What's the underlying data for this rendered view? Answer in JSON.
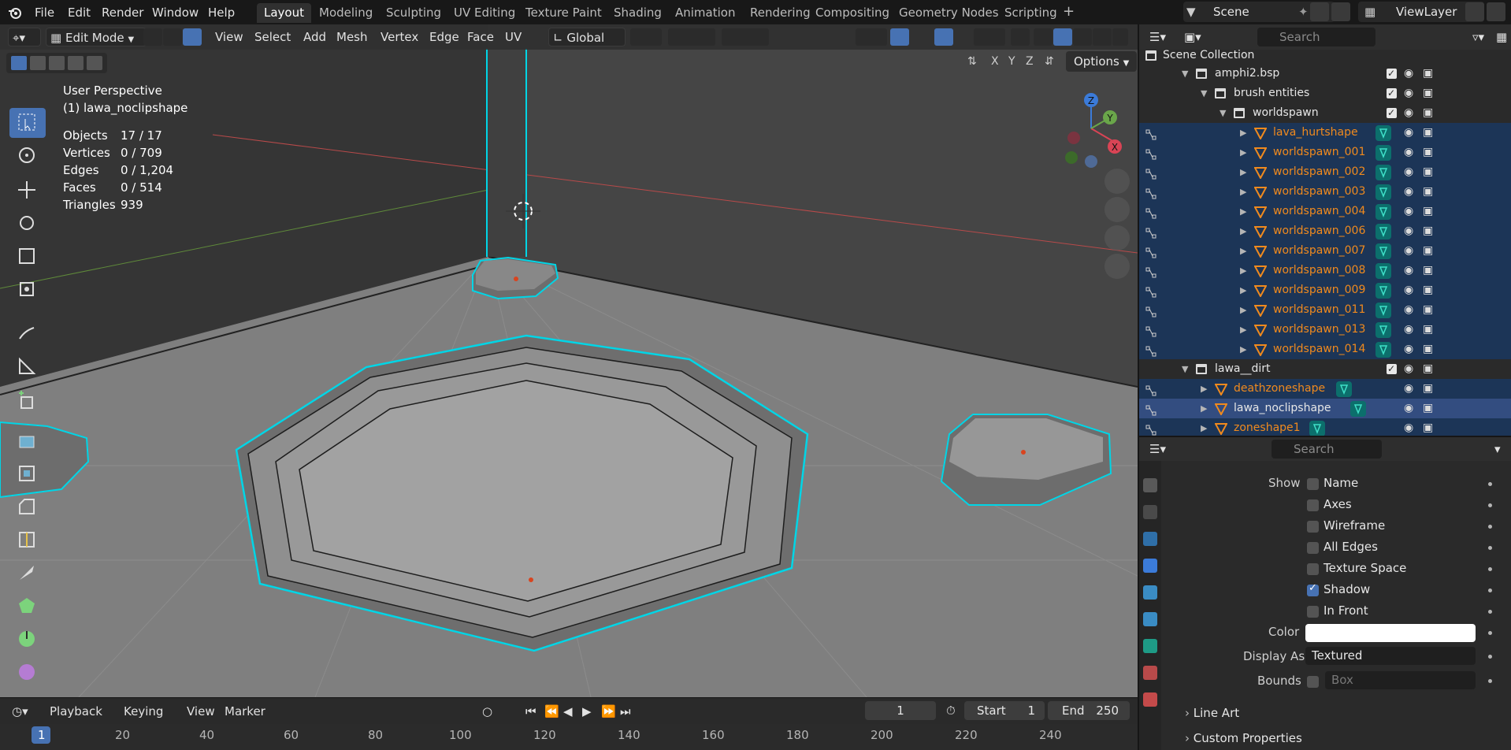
{
  "menu": {
    "file": "File",
    "edit": "Edit",
    "render": "Render",
    "window": "Window",
    "help": "Help"
  },
  "workspaces": [
    "Layout",
    "Modeling",
    "Sculpting",
    "UV Editing",
    "Texture Paint",
    "Shading",
    "Animation",
    "Rendering",
    "Compositing",
    "Geometry Nodes",
    "Scripting"
  ],
  "active_workspace": "Layout",
  "scene": "Scene",
  "view_layer": "ViewLayer",
  "viewport_header": {
    "mode": "Edit Mode",
    "view": "View",
    "select": "Select",
    "add": "Add",
    "mesh": "Mesh",
    "vertex": "Vertex",
    "edge": "Edge",
    "face": "Face",
    "uv": "UV",
    "orientation": "Global",
    "options": "Options",
    "axis_x": "X",
    "axis_y": "Y",
    "axis_z": "Z"
  },
  "overlay": {
    "perspective": "User Perspective",
    "object": "(1) lawa_noclipshape",
    "stats": [
      {
        "label": "Objects",
        "value": "17 / 17"
      },
      {
        "label": "Vertices",
        "value": "0 / 709"
      },
      {
        "label": "Edges",
        "value": "0 / 1,204"
      },
      {
        "label": "Faces",
        "value": "0 / 514"
      },
      {
        "label": "Triangles",
        "value": "939"
      }
    ]
  },
  "gizmo": {
    "z": "Z",
    "y": "Y",
    "x": "X"
  },
  "timeline": {
    "playback": "Playback",
    "keying": "Keying",
    "view": "View",
    "marker": "Marker",
    "current_frame": "1",
    "start_label": "Start",
    "start": "1",
    "end_label": "End",
    "end": "250",
    "ticks": [
      "1",
      "20",
      "40",
      "60",
      "80",
      "100",
      "120",
      "140",
      "160",
      "180",
      "200",
      "220",
      "240"
    ]
  },
  "outliner": {
    "search_placeholder": "Search",
    "scene_collection": "Scene Collection",
    "items": [
      {
        "label": "amphi2.bsp",
        "kind": "collection"
      },
      {
        "label": "brush entities",
        "kind": "collection"
      },
      {
        "label": "worldspawn",
        "kind": "collection"
      },
      {
        "label": "lava_hurtshape",
        "kind": "mesh"
      },
      {
        "label": "worldspawn_001",
        "kind": "mesh"
      },
      {
        "label": "worldspawn_002",
        "kind": "mesh"
      },
      {
        "label": "worldspawn_003",
        "kind": "mesh"
      },
      {
        "label": "worldspawn_004",
        "kind": "mesh"
      },
      {
        "label": "worldspawn_006",
        "kind": "mesh"
      },
      {
        "label": "worldspawn_007",
        "kind": "mesh"
      },
      {
        "label": "worldspawn_008",
        "kind": "mesh"
      },
      {
        "label": "worldspawn_009",
        "kind": "mesh"
      },
      {
        "label": "worldspawn_011",
        "kind": "mesh"
      },
      {
        "label": "worldspawn_013",
        "kind": "mesh"
      },
      {
        "label": "worldspawn_014",
        "kind": "mesh"
      },
      {
        "label": "lawa__dirt",
        "kind": "collection"
      },
      {
        "label": "deathzoneshape",
        "kind": "mesh"
      },
      {
        "label": "lawa_noclipshape",
        "kind": "mesh"
      },
      {
        "label": "zoneshape1",
        "kind": "mesh"
      }
    ]
  },
  "properties": {
    "search_placeholder": "Search",
    "show_label": "Show",
    "show_options": [
      {
        "label": "Name",
        "checked": false
      },
      {
        "label": "Axes",
        "checked": false
      },
      {
        "label": "Wireframe",
        "checked": false
      },
      {
        "label": "All Edges",
        "checked": false
      },
      {
        "label": "Texture Space",
        "checked": false
      },
      {
        "label": "Shadow",
        "checked": true
      },
      {
        "label": "In Front",
        "checked": false
      }
    ],
    "color_label": "Color",
    "color_value": "#ffffff",
    "display_as_label": "Display As",
    "display_as": "Textured",
    "bounds_label": "Bounds",
    "bounds_value": "Box",
    "panels": [
      "Line Art",
      "Custom Properties"
    ]
  },
  "colors": {
    "selection_outline": "#00d5e6",
    "active_blue": "#4772b3",
    "object_orange": "#f08a1e"
  }
}
